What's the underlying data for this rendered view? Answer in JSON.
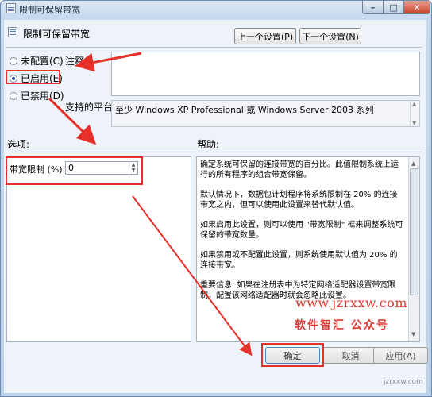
{
  "window": {
    "title": "限制可保留带宽",
    "controls": {
      "minimize": "–",
      "maximize": "□",
      "close": "✕"
    }
  },
  "header": {
    "policy_title": "限制可保留带宽",
    "prev_button": "上一个设置(P)",
    "next_button": "下一个设置(N)"
  },
  "radio_options": [
    {
      "label": "未配置(C)",
      "selected": false
    },
    {
      "label": "已启用(E)",
      "selected": true
    },
    {
      "label": "已禁用(D)",
      "selected": false
    }
  ],
  "comment": {
    "label": "注释:",
    "value": ""
  },
  "supported": {
    "label": "支持的平台:",
    "value": "至少 Windows XP Professional 或 Windows Server 2003 系列"
  },
  "options": {
    "section_label": "选项:",
    "bandwidth_label": "带宽限制 (%):",
    "bandwidth_value": "0"
  },
  "help": {
    "section_label": "帮助:",
    "paragraphs": [
      "确定系统可保留的连接带宽的百分比。此值限制系统上运行的所有程序的组合带宽保留。",
      "默认情况下，数据包计划程序将系统限制在 20% 的连接带宽之内，但可以使用此设置来替代默认值。",
      "如果启用此设置，则可以使用 \"带宽限制\" 框来调整系统可保留的带宽数量。",
      "如果禁用或不配置此设置，则系统使用默认值为 20% 的连接带宽。",
      "重要信息: 如果在注册表中为特定网络适配器设置带宽限制，配置该网络适配器时就会忽略此设置。"
    ]
  },
  "footer": {
    "ok": "确定",
    "cancel": "取消",
    "apply": "应用(A)"
  },
  "watermark": {
    "url": "www.jzrxxw.com",
    "text": "软件智汇 公众号",
    "small": "jzrxxw.com"
  },
  "colors": {
    "annotation_red": "#e8302a",
    "watermark_red": "#d83a32"
  }
}
